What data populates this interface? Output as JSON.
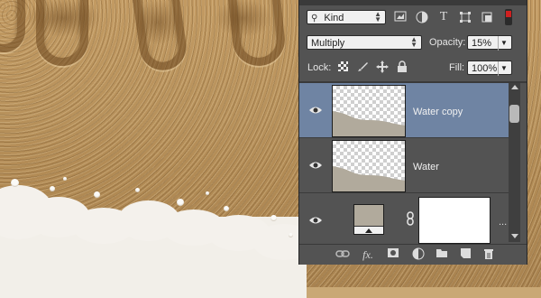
{
  "canvas": {
    "description_icon": "sand-with-writing"
  },
  "layers_panel": {
    "filter_kind": "Kind",
    "blend_mode": "Multiply",
    "opacity_label": "Opacity:",
    "opacity_value": "15%",
    "lock_label": "Lock:",
    "fill_label": "Fill:",
    "fill_value": "100%",
    "layers": [
      {
        "name": "Water copy",
        "selected": true
      },
      {
        "name": "Water",
        "selected": false
      },
      {
        "name": "",
        "selected": false
      }
    ],
    "overflow_mark": "...",
    "colors": {
      "selected_row": "#6f84a3",
      "panel_bg": "#535353",
      "swatch": "#b1aa9c"
    }
  }
}
